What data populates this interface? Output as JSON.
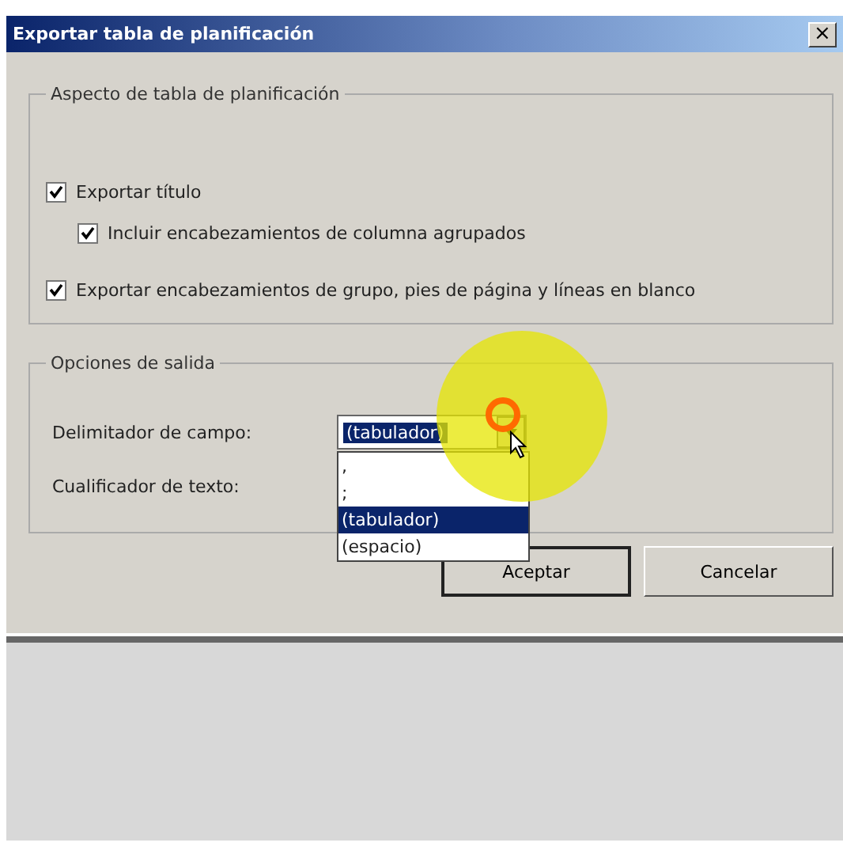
{
  "window": {
    "title": "Exportar tabla de planificación",
    "close": "×"
  },
  "appearance": {
    "title": "Aspecto de tabla de planificación",
    "options": [
      {
        "label": "Exportar título",
        "checked": true,
        "children": [
          {
            "label": "Incluir encabezamientos de columna agrupados",
            "checked": true
          }
        ]
      },
      {
        "label": "Exportar encabezamientos de grupo, pies de página y líneas en blanco",
        "checked": true
      }
    ]
  },
  "output": {
    "title": "Opciones de salida",
    "field_delimiter": {
      "label": "Delimitador de campo:",
      "value": "(tabulador)",
      "expanded": true,
      "options": [
        {
          "label": ",",
          "selected": false
        },
        {
          "label": ";",
          "selected": false
        },
        {
          "label": "(tabulador)",
          "selected": true
        },
        {
          "label": "(espacio)",
          "selected": false
        }
      ]
    },
    "text_qualifier": {
      "label": "Cualificador de texto:"
    }
  },
  "buttons": [
    {
      "label": "Aceptar",
      "default": true
    },
    {
      "label": "Cancelar",
      "default": false
    }
  ]
}
